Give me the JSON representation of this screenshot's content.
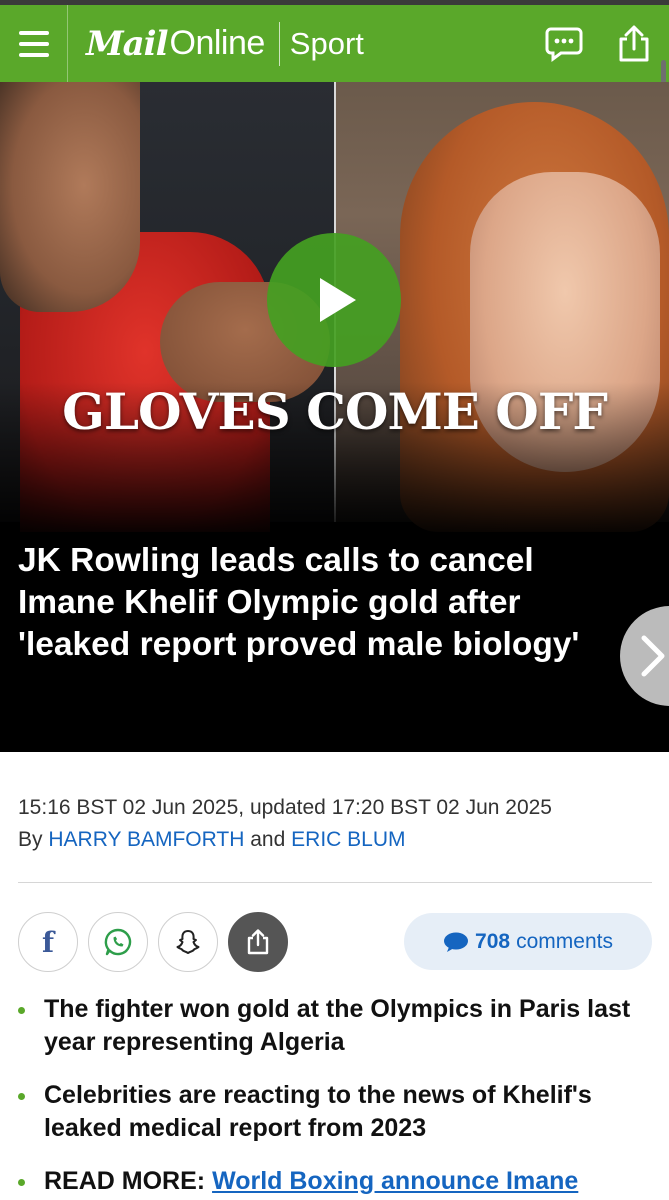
{
  "header": {
    "logo_bold": "Mail",
    "logo_regular": "Online",
    "section": "Sport",
    "menu_icon": "hamburger-icon",
    "comment_icon": "speech-bubble-icon",
    "share_icon": "share-upload-icon"
  },
  "hero": {
    "overlay_text": "GLOVES COME OFF",
    "play_icon": "play-icon",
    "headline": "JK Rowling leads calls to cancel Imane Khelif Olympic gold after 'leaked report proved male biology'",
    "next_icon": "chevron-right-icon"
  },
  "meta": {
    "timestamp": "15:16 BST 02 Jun 2025, updated 17:20 BST 02 Jun 2025",
    "by": "By",
    "author1": "HARRY BAMFORTH",
    "and": "and",
    "author2": "ERIC BLUM"
  },
  "social": {
    "count": "708",
    "label": "comments"
  },
  "bullets": {
    "item1": "The fighter won gold at the Olympics in Paris last year representing Algeria",
    "item2": "Celebrities are reacting to the news of Khelif's leaked medical report from 2023",
    "readmore_label": "READ MORE:",
    "readmore_link": "World Boxing announce Imane"
  },
  "colors": {
    "brand_green": "#5aa82a",
    "link_blue": "#1565c0"
  }
}
